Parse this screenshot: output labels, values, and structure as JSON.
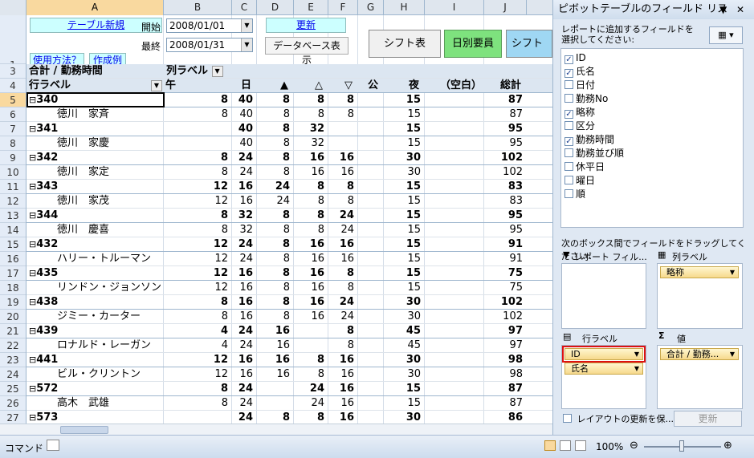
{
  "columns": [
    "A",
    "B",
    "C",
    "D",
    "E",
    "F",
    "G",
    "H",
    "I",
    "J"
  ],
  "selected_column": "A",
  "row_numbers": [
    "1",
    "2",
    "3",
    "4",
    "5",
    "6",
    "7",
    "8",
    "9",
    "10",
    "11",
    "12",
    "13",
    "14",
    "15",
    "16",
    "17",
    "18",
    "19",
    "20",
    "21",
    "22",
    "23",
    "24",
    "25",
    "26",
    "27"
  ],
  "selected_row": "5",
  "controls": {
    "new_table_link": "テーブル新規",
    "how_to_use_link": "使用方法？",
    "example_link": "作成例",
    "start_label": "開始",
    "start_value": "2008/01/01",
    "end_label": "最終",
    "end_value": "2008/01/31",
    "update_button": "更新",
    "db_button": "データベース表示",
    "sheet_buttons": [
      "シフト表",
      "日別要員",
      "シフト"
    ]
  },
  "pivot": {
    "data_label": "合計 / 勤務時間",
    "col_label": "列ラベル",
    "row_label": "行ラベル",
    "col_headers": [
      "午",
      "日",
      "▲",
      "△",
      "▽",
      "公",
      "夜",
      "（空白）",
      "総計"
    ],
    "rows": [
      {
        "name": "340",
        "group": true,
        "vals": [
          "8",
          "40",
          "8",
          "8",
          "8",
          "",
          "15",
          "",
          "87"
        ]
      },
      {
        "name": "徳川　家斉",
        "group": false,
        "vals": [
          "8",
          "40",
          "8",
          "8",
          "8",
          "",
          "15",
          "",
          "87"
        ]
      },
      {
        "name": "341",
        "group": true,
        "vals": [
          "",
          "40",
          "8",
          "32",
          "",
          "",
          "15",
          "",
          "95"
        ]
      },
      {
        "name": "徳川　家慶",
        "group": false,
        "vals": [
          "",
          "40",
          "8",
          "32",
          "",
          "",
          "15",
          "",
          "95"
        ]
      },
      {
        "name": "342",
        "group": true,
        "vals": [
          "8",
          "24",
          "8",
          "16",
          "16",
          "",
          "30",
          "",
          "102"
        ]
      },
      {
        "name": "徳川　家定",
        "group": false,
        "vals": [
          "8",
          "24",
          "8",
          "16",
          "16",
          "",
          "30",
          "",
          "102"
        ]
      },
      {
        "name": "343",
        "group": true,
        "vals": [
          "12",
          "16",
          "24",
          "8",
          "8",
          "",
          "15",
          "",
          "83"
        ]
      },
      {
        "name": "徳川　家茂",
        "group": false,
        "vals": [
          "12",
          "16",
          "24",
          "8",
          "8",
          "",
          "15",
          "",
          "83"
        ]
      },
      {
        "name": "344",
        "group": true,
        "vals": [
          "8",
          "32",
          "8",
          "8",
          "24",
          "",
          "15",
          "",
          "95"
        ]
      },
      {
        "name": "徳川　慶喜",
        "group": false,
        "vals": [
          "8",
          "32",
          "8",
          "8",
          "24",
          "",
          "15",
          "",
          "95"
        ]
      },
      {
        "name": "432",
        "group": true,
        "vals": [
          "12",
          "24",
          "8",
          "16",
          "16",
          "",
          "15",
          "",
          "91"
        ]
      },
      {
        "name": "ハリー・トルーマン",
        "group": false,
        "vals": [
          "12",
          "24",
          "8",
          "16",
          "16",
          "",
          "15",
          "",
          "91"
        ]
      },
      {
        "name": "435",
        "group": true,
        "vals": [
          "12",
          "16",
          "8",
          "16",
          "8",
          "",
          "15",
          "",
          "75"
        ]
      },
      {
        "name": "リンドン・ジョンソン",
        "group": false,
        "vals": [
          "12",
          "16",
          "8",
          "16",
          "8",
          "",
          "15",
          "",
          "75"
        ]
      },
      {
        "name": "438",
        "group": true,
        "vals": [
          "8",
          "16",
          "8",
          "16",
          "24",
          "",
          "30",
          "",
          "102"
        ]
      },
      {
        "name": "ジミー・カーター",
        "group": false,
        "vals": [
          "8",
          "16",
          "8",
          "16",
          "24",
          "",
          "30",
          "",
          "102"
        ]
      },
      {
        "name": "439",
        "group": true,
        "vals": [
          "4",
          "24",
          "16",
          "",
          "8",
          "",
          "45",
          "",
          "97"
        ]
      },
      {
        "name": "ロナルド・レーガン",
        "group": false,
        "vals": [
          "4",
          "24",
          "16",
          "",
          "8",
          "",
          "45",
          "",
          "97"
        ]
      },
      {
        "name": "441",
        "group": true,
        "vals": [
          "12",
          "16",
          "16",
          "8",
          "16",
          "",
          "30",
          "",
          "98"
        ]
      },
      {
        "name": "ビル・クリントン",
        "group": false,
        "vals": [
          "12",
          "16",
          "16",
          "8",
          "16",
          "",
          "30",
          "",
          "98"
        ]
      },
      {
        "name": "572",
        "group": true,
        "vals": [
          "8",
          "24",
          "",
          "24",
          "16",
          "",
          "15",
          "",
          "87"
        ]
      },
      {
        "name": "高木　武雄",
        "group": false,
        "vals": [
          "8",
          "24",
          "",
          "24",
          "16",
          "",
          "15",
          "",
          "87"
        ]
      },
      {
        "name": "573",
        "group": true,
        "vals": [
          "",
          "24",
          "8",
          "8",
          "16",
          "",
          "30",
          "",
          "86"
        ]
      }
    ]
  },
  "panel": {
    "title": "ピボットテーブルのフィールド リス",
    "description": "レポートに追加するフィールドを選択してください:",
    "fields": [
      {
        "label": "ID",
        "checked": true
      },
      {
        "label": "氏名",
        "checked": true
      },
      {
        "label": "日付",
        "checked": false
      },
      {
        "label": "勤務No",
        "checked": false
      },
      {
        "label": "略称",
        "checked": true
      },
      {
        "label": "区分",
        "checked": false
      },
      {
        "label": "勤務時間",
        "checked": true
      },
      {
        "label": "勤務並び順",
        "checked": false
      },
      {
        "label": "休平日",
        "checked": false
      },
      {
        "label": "曜日",
        "checked": false
      },
      {
        "label": "順",
        "checked": false
      }
    ],
    "drag_text": "次のボックス間でフィールドをドラッグしてください:",
    "report_filter_label": "レポート フィル...",
    "column_label_label": "列ラベル",
    "row_label_label": "行ラベル",
    "values_label": "値",
    "column_fields": [
      "略称"
    ],
    "row_fields": [
      "ID",
      "氏名"
    ],
    "value_fields": [
      "合計 / 勤務..."
    ],
    "defer_label": "レイアウトの更新を保...",
    "update_button": "更新"
  },
  "status": {
    "mode": "コマンド",
    "zoom": "100%"
  }
}
